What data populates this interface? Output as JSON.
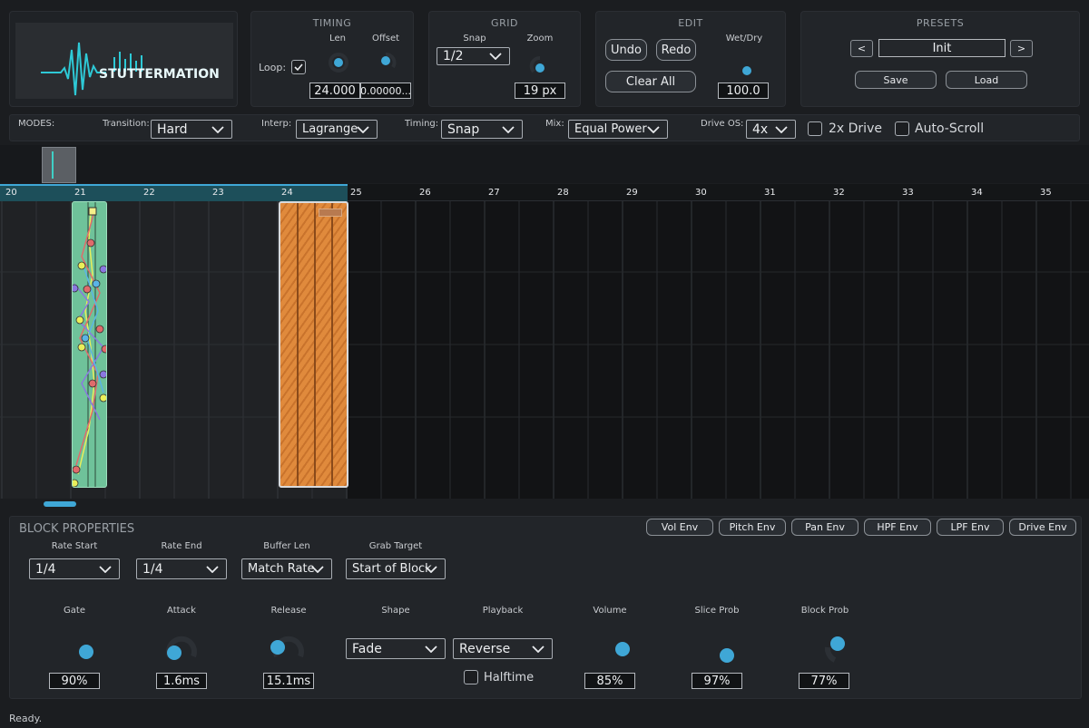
{
  "timing": {
    "title": "TIMING",
    "len_label": "Len",
    "offset_label": "Offset",
    "loop_label": "Loop:",
    "len_value": "24.000",
    "offset_value": "0.00000..."
  },
  "grid": {
    "title": "GRID",
    "snap_label": "Snap",
    "zoom_label": "Zoom",
    "snap_value": "1/2",
    "zoom_value": "19 px"
  },
  "edit": {
    "title": "EDIT",
    "undo": "Undo",
    "redo": "Redo",
    "clear_all": "Clear All",
    "wetdry_label": "Wet/Dry",
    "wetdry_value": "100.0"
  },
  "presets": {
    "title": "PRESETS",
    "prev": "<",
    "next": ">",
    "name": "Init",
    "save": "Save",
    "load": "Load"
  },
  "modes": {
    "label": "MODES:",
    "transition_label": "Transition:",
    "transition_value": "Hard",
    "interp_label": "Interp:",
    "interp_value": "Lagrange",
    "timing_label": "Timing:",
    "timing_value": "Snap",
    "mix_label": "Mix:",
    "mix_value": "Equal Power",
    "driveos_label": "Drive OS:",
    "driveos_value": "4x",
    "drive2x_label": "2x Drive",
    "autoscroll_label": "Auto-Scroll"
  },
  "ruler": {
    "ticks": [
      "20",
      "21",
      "22",
      "23",
      "24",
      "25",
      "26",
      "27",
      "28",
      "29",
      "30",
      "31",
      "32",
      "33",
      "34",
      "35"
    ]
  },
  "block_props": {
    "title": "BLOCK PROPERTIES",
    "env_buttons": [
      "Vol Env",
      "Pitch Env",
      "Pan Env",
      "HPF Env",
      "LPF Env",
      "Drive Env"
    ],
    "rate_start_label": "Rate Start",
    "rate_start_value": "1/4",
    "rate_end_label": "Rate End",
    "rate_end_value": "1/4",
    "buffer_len_label": "Buffer Len",
    "buffer_len_value": "Match Rate",
    "grab_target_label": "Grab Target",
    "grab_target_value": "Start of Block",
    "gate_label": "Gate",
    "gate_value": "90%",
    "attack_label": "Attack",
    "attack_value": "1.6ms",
    "release_label": "Release",
    "release_value": "15.1ms",
    "shape_label": "Shape",
    "shape_value": "Fade",
    "playback_label": "Playback",
    "playback_value": "Reverse",
    "halftime_label": "Halftime",
    "volume_label": "Volume",
    "volume_value": "85%",
    "slice_prob_label": "Slice Prob",
    "slice_prob_value": "97%",
    "block_prob_label": "Block Prob",
    "block_prob_value": "77%"
  },
  "status": "Ready.",
  "colors": {
    "accent": "#3fa7d6",
    "green_block": "#6fc29a",
    "orange_block": "#e08a3c",
    "ruler": "#1d4f5a"
  }
}
